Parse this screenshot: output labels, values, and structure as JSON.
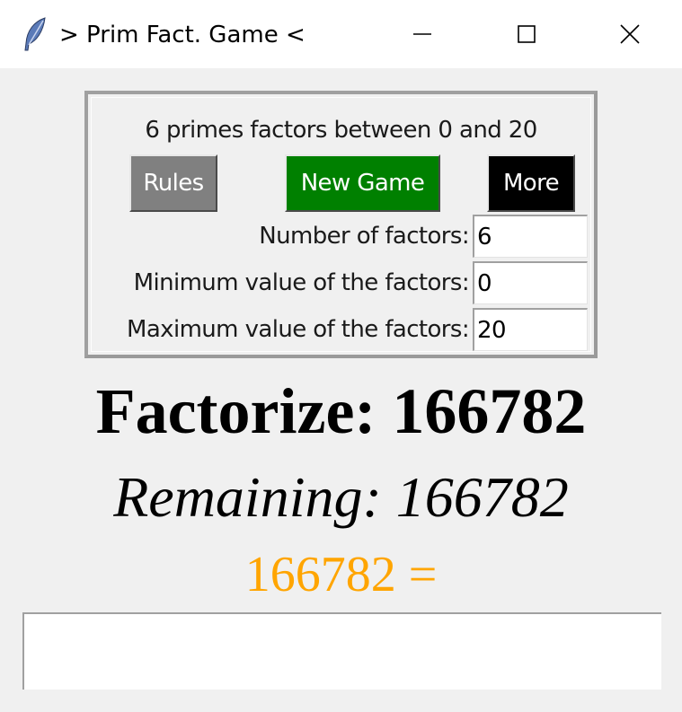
{
  "window": {
    "title": "> Prim Fact. Game <",
    "icon": "feather-icon"
  },
  "settings": {
    "summary": "6 primes factors between 0 and 20",
    "buttons": {
      "rules": "Rules",
      "new_game": "New Game",
      "more": "More"
    },
    "fields": {
      "num_factors": {
        "label": "Number of factors:",
        "value": "6"
      },
      "min_value": {
        "label": "Minimum value of the factors:",
        "value": "0"
      },
      "max_value": {
        "label": "Maximum value of the factors:",
        "value": "20"
      }
    }
  },
  "game": {
    "factorize": "Factorize: 166782",
    "remaining": "Remaining: 166782",
    "equation": "166782 ="
  },
  "answer": {
    "value": ""
  },
  "colors": {
    "rules_button": "#808080",
    "new_game_button": "#008000",
    "more_button": "#000000",
    "equation_text": "#ffa500",
    "background": "#f0f0f0"
  }
}
